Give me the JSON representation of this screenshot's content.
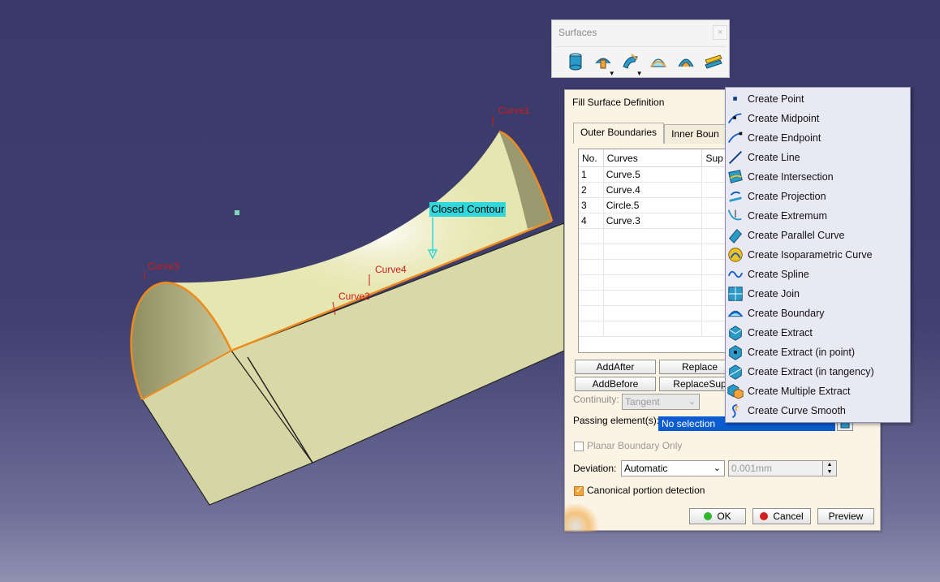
{
  "viewport": {
    "closed_contour_label": "Closed Contour",
    "curve_labels": [
      "Curve1",
      "Curve3",
      "Curve4",
      "Curve2"
    ]
  },
  "toolbar": {
    "title": "Surfaces",
    "close_glyph": "×",
    "icons": [
      "extrude-icon",
      "revolve-icon",
      "sweep-icon",
      "fill-icon",
      "multi-section-icon",
      "blend-icon"
    ]
  },
  "dialog": {
    "title": "Fill Surface Definition",
    "tabs": [
      "Outer Boundaries",
      "Inner Boun"
    ],
    "columns": [
      "No.",
      "Curves",
      "Sup"
    ],
    "rows": [
      {
        "no": "1",
        "curve": "Curve.5"
      },
      {
        "no": "2",
        "curve": "Curve.4"
      },
      {
        "no": "3",
        "curve": "Circle.5"
      },
      {
        "no": "4",
        "curve": "Curve.3"
      }
    ],
    "buttons": {
      "add_after": "AddAfter",
      "replace": "Replace",
      "add_before": "AddBefore",
      "replace_sup": "ReplaceSup"
    },
    "continuity_label": "Continuity:",
    "continuity_value": "Tangent",
    "passing_label": "Passing element(s):",
    "passing_value": "No selection",
    "planar_label": "Planar Boundary Only",
    "deviation_label": "Deviation:",
    "deviation_value": "Automatic",
    "deviation_amount": "0.001mm",
    "canonical_label": "Canonical portion detection",
    "ok": "OK",
    "cancel": "Cancel",
    "preview": "Preview"
  },
  "menu": {
    "items": [
      {
        "label": "Create Point",
        "icon": "point-icon"
      },
      {
        "label": "Create Midpoint",
        "icon": "midpoint-icon"
      },
      {
        "label": "Create Endpoint",
        "icon": "endpoint-icon"
      },
      {
        "label": "Create Line",
        "icon": "line-icon"
      },
      {
        "label": "Create Intersection",
        "icon": "intersection-icon"
      },
      {
        "label": "Create Projection",
        "icon": "projection-icon"
      },
      {
        "label": "Create Extremum",
        "icon": "extremum-icon"
      },
      {
        "label": "Create Parallel Curve",
        "icon": "parallel-curve-icon"
      },
      {
        "label": "Create Isoparametric Curve",
        "icon": "isoparametric-icon"
      },
      {
        "label": "Create Spline",
        "icon": "spline-icon"
      },
      {
        "label": "Create Join",
        "icon": "join-icon"
      },
      {
        "label": "Create Boundary",
        "icon": "boundary-icon"
      },
      {
        "label": "Create Extract",
        "icon": "extract-icon"
      },
      {
        "label": "Create Extract (in point)",
        "icon": "extract-point-icon"
      },
      {
        "label": "Create Extract (in tangency)",
        "icon": "extract-tangency-icon"
      },
      {
        "label": "Create Multiple Extract",
        "icon": "multiple-extract-icon"
      },
      {
        "label": "Create Curve Smooth",
        "icon": "curve-smooth-icon"
      }
    ]
  },
  "colors": {
    "background": "#3a3a6a",
    "surface": "#e6e6b0",
    "boundary": "#f08a1a",
    "label_red": "#d01a1a",
    "contour_cyan": "#2fd8dc",
    "selection_blue": "#0a5cd0"
  }
}
